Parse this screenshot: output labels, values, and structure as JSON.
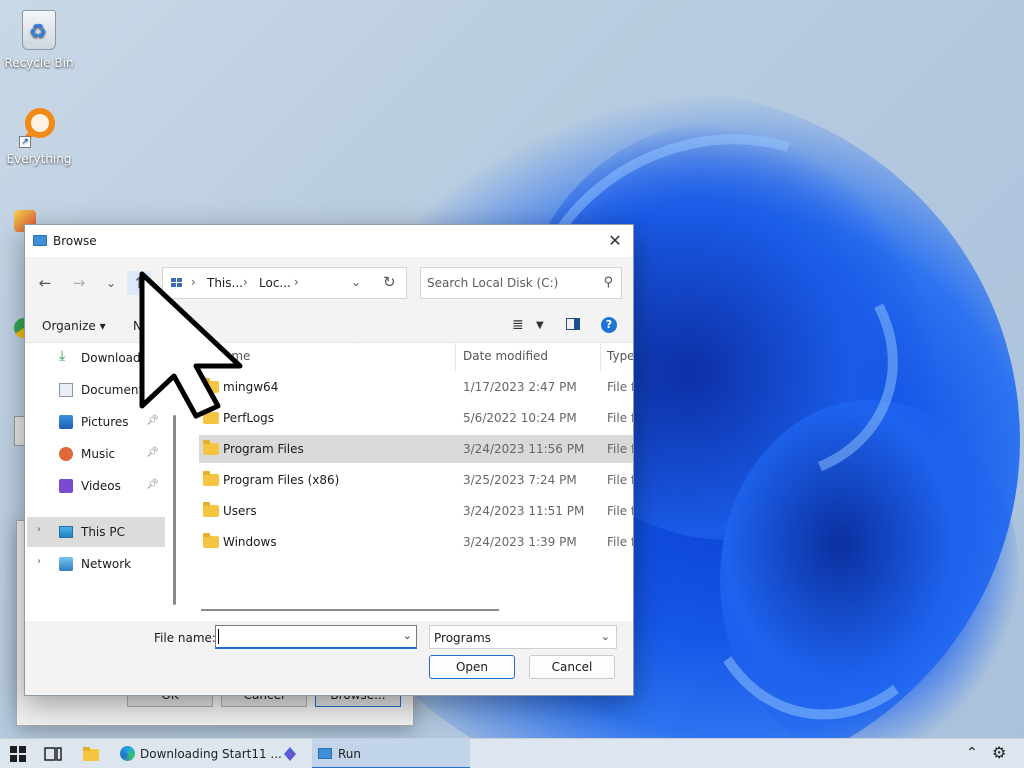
{
  "desktop": {
    "icons": [
      {
        "label": "Recycle Bin",
        "icon": "recycle-bin-icon"
      },
      {
        "label": "Everything",
        "icon": "everything-search-icon"
      }
    ]
  },
  "run_dialog": {
    "ok_label": "OK",
    "cancel_label": "Cancel",
    "browse_label": "Browse..."
  },
  "browse_dialog": {
    "title": "Browse",
    "close_glyph": "✕",
    "nav": {
      "back_glyph": "←",
      "forward_glyph": "→",
      "recent_glyph": "⌄",
      "up_glyph": "↑"
    },
    "address": {
      "segments": [
        "This...",
        "Loc..."
      ],
      "separator": "›"
    },
    "search": {
      "placeholder": "Search Local Disk (C:)"
    },
    "toolbar": {
      "organize_label": "Organize ▾",
      "new_folder_label": "N"
    },
    "sidebar": {
      "items": [
        {
          "label": "Downloads",
          "icon": "download-icon",
          "pinned": true
        },
        {
          "label": "Documents",
          "icon": "document-icon",
          "pinned": true
        },
        {
          "label": "Pictures",
          "icon": "pictures-icon",
          "pinned": true
        },
        {
          "label": "Music",
          "icon": "music-icon",
          "pinned": true
        },
        {
          "label": "Videos",
          "icon": "videos-icon",
          "pinned": true
        },
        {
          "label": "This PC",
          "icon": "computer-icon",
          "selected": true
        },
        {
          "label": "Network",
          "icon": "network-icon"
        }
      ]
    },
    "columns": {
      "name": "Name",
      "date": "Date modified",
      "type": "Type"
    },
    "files": [
      {
        "name": "mingw64",
        "date": "1/17/2023 2:47 PM",
        "type": "File fo"
      },
      {
        "name": "PerfLogs",
        "date": "5/6/2022 10:24 PM",
        "type": "File fo"
      },
      {
        "name": "Program Files",
        "date": "3/24/2023 11:56 PM",
        "type": "File fo",
        "selected": true
      },
      {
        "name": "Program Files (x86)",
        "date": "3/25/2023 7:24 PM",
        "type": "File fo"
      },
      {
        "name": "Users",
        "date": "3/24/2023 11:51 PM",
        "type": "File fo"
      },
      {
        "name": "Windows",
        "date": "3/24/2023 1:39 PM",
        "type": "File fo"
      }
    ],
    "footer": {
      "file_name_label": "File name:",
      "file_name_value": "",
      "file_type_value": "Programs",
      "open_label": "Open",
      "cancel_label": "Cancel"
    }
  },
  "taskbar": {
    "apps": [
      {
        "label": "Downloading Start11 ...",
        "icon": "edge-icon"
      },
      {
        "label": "Run",
        "icon": "run-icon",
        "active": true
      }
    ]
  },
  "colors": {
    "accent": "#1f6fd1",
    "selection": "#d9d9d9",
    "folder": "#f5c542"
  }
}
